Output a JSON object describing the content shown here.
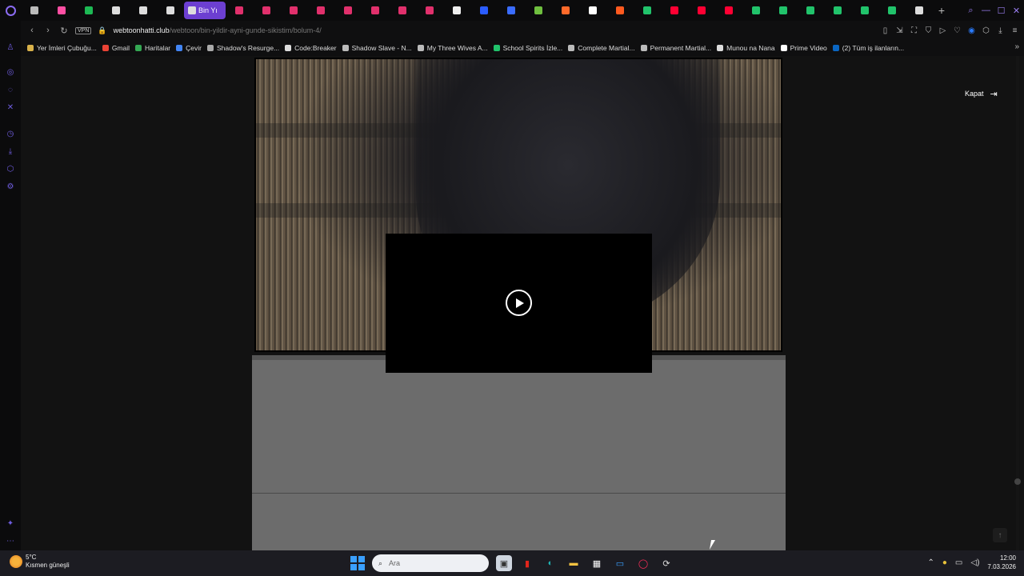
{
  "browser": {
    "tabs": [
      {
        "icon": "tab-icon",
        "color": "#bbbbbb"
      },
      {
        "icon": "threads-icon",
        "color": "#ff4fa3"
      },
      {
        "icon": "spotify-icon",
        "color": "#1db954"
      },
      {
        "icon": "comic-icon",
        "color": "#dddddd"
      },
      {
        "icon": "comic-icon",
        "color": "#dddddd"
      },
      {
        "icon": "comic-icon",
        "color": "#dddddd"
      },
      {
        "icon": "comic-icon",
        "color": "#dddddd",
        "active": true,
        "label": "Bin Yı"
      },
      {
        "icon": "instagram-icon",
        "color": "#e1306c"
      },
      {
        "icon": "instagram-icon",
        "color": "#e1306c"
      },
      {
        "icon": "instagram-icon",
        "color": "#e1306c"
      },
      {
        "icon": "instagram-icon",
        "color": "#e1306c"
      },
      {
        "icon": "instagram-icon",
        "color": "#e1306c"
      },
      {
        "icon": "instagram-icon",
        "color": "#e1306c"
      },
      {
        "icon": "instagram-icon",
        "color": "#e1306c"
      },
      {
        "icon": "instagram-icon",
        "color": "#e1306c"
      },
      {
        "icon": "k-icon",
        "color": "#eeeeee"
      },
      {
        "icon": "site-icon",
        "color": "#2a5cff"
      },
      {
        "icon": "calendar-icon",
        "color": "#3a6cff"
      },
      {
        "icon": "shopify-icon",
        "color": "#6fbf3f"
      },
      {
        "icon": "chart-icon",
        "color": "#ff6a2a"
      },
      {
        "icon": "notion-icon",
        "color": "#ffffff"
      },
      {
        "icon": "e-icon",
        "color": "#ff5a1f"
      },
      {
        "icon": "v-icon",
        "color": "#21c36b"
      },
      {
        "icon": "youtube-icon",
        "color": "#ff0033"
      },
      {
        "icon": "youtube-icon",
        "color": "#ff0033"
      },
      {
        "icon": "youtube-icon",
        "color": "#ff0033"
      },
      {
        "icon": "v-icon",
        "color": "#21c36b"
      },
      {
        "icon": "v-icon",
        "color": "#21c36b"
      },
      {
        "icon": "v-icon",
        "color": "#21c36b"
      },
      {
        "icon": "v-icon",
        "color": "#21c36b"
      },
      {
        "icon": "v-icon",
        "color": "#21c36b"
      },
      {
        "icon": "v-icon",
        "color": "#21c36b"
      },
      {
        "icon": "comic-icon",
        "color": "#dddddd"
      }
    ],
    "url": {
      "domain": "webtoonhatti.club",
      "path": "/webtoon/bin-yildir-ayni-gunde-sikistim/bolum-4/"
    },
    "vpn_label": "VPN",
    "bookmarks": [
      {
        "label": "Yer İmleri Çubuğu...",
        "color": "#d9b24a"
      },
      {
        "label": "Gmail",
        "color": "#ea4335"
      },
      {
        "label": "Haritalar",
        "color": "#34a853"
      },
      {
        "label": "Çevir",
        "color": "#4285f4"
      },
      {
        "label": "Shadow's Resurge...",
        "color": "#aaaaaa"
      },
      {
        "label": "Code:Breaker",
        "color": "#dddddd"
      },
      {
        "label": "Shadow Slave - N...",
        "color": "#bbbbbb"
      },
      {
        "label": "My Three Wives A...",
        "color": "#bbbbbb"
      },
      {
        "label": "School Spirits İzle...",
        "color": "#21c36b"
      },
      {
        "label": "Complete Martial...",
        "color": "#bbbbbb"
      },
      {
        "label": "Permanent Martial...",
        "color": "#bbbbbb"
      },
      {
        "label": "Munou na Nana",
        "color": "#dddddd"
      },
      {
        "label": "Prime Video",
        "color": "#ffffff"
      },
      {
        "label": "(2) Tüm iş ilanların...",
        "color": "#0a66c2"
      }
    ]
  },
  "page": {
    "close_label": "Kapat"
  },
  "taskbar": {
    "weather_temp": "5°C",
    "weather_desc": "Kısmen güneşli",
    "search_placeholder": "Ara",
    "time": "12:00",
    "date": "7.03.2026"
  }
}
